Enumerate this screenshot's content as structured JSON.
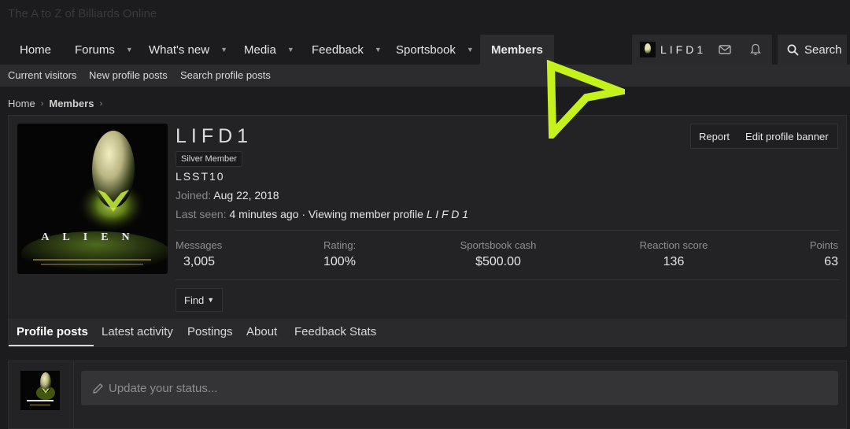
{
  "site": {
    "title": "The A to Z of Billiards Online"
  },
  "nav": {
    "items": [
      {
        "label": "Home"
      },
      {
        "label": "Forums"
      },
      {
        "label": "What's new"
      },
      {
        "label": "Media"
      },
      {
        "label": "Feedback"
      },
      {
        "label": "Sportsbook"
      },
      {
        "label": "Members"
      }
    ],
    "user_name": "LIFD1",
    "search_label": "Search"
  },
  "subnav": {
    "items": [
      {
        "label": "Current visitors"
      },
      {
        "label": "New profile posts"
      },
      {
        "label": "Search profile posts"
      }
    ]
  },
  "breadcrumb": {
    "home": "Home",
    "current": "Members"
  },
  "profile": {
    "name": "LIFD1",
    "badge": "Silver Member",
    "custom_title": "LSST10",
    "avatar_text": "ALIEN",
    "joined_label": "Joined:",
    "joined_value": "Aug 22, 2018",
    "last_seen_label": "Last seen:",
    "last_seen_time": "4 minutes ago",
    "last_seen_activity": " · Viewing member profile ",
    "last_seen_target": "L I F D 1",
    "actions": {
      "report": "Report",
      "edit_banner": "Edit profile banner"
    },
    "stats": [
      {
        "label": "Messages",
        "value": "3,005"
      },
      {
        "label": "Rating:",
        "value": "100%"
      },
      {
        "label": "Sportsbook cash",
        "value": "$500.00"
      },
      {
        "label": "Reaction score",
        "value": "136"
      },
      {
        "label": "Points",
        "value": "63"
      }
    ],
    "find_label": "Find"
  },
  "tabs": [
    {
      "label": "Profile posts"
    },
    {
      "label": "Latest activity"
    },
    {
      "label": "Postings"
    },
    {
      "label": "About"
    },
    {
      "label": "Feedback Stats"
    }
  ],
  "status": {
    "placeholder": "Update your status..."
  },
  "colors": {
    "accent_cursor": "#c5f21b",
    "background": "#1c1c1e"
  }
}
